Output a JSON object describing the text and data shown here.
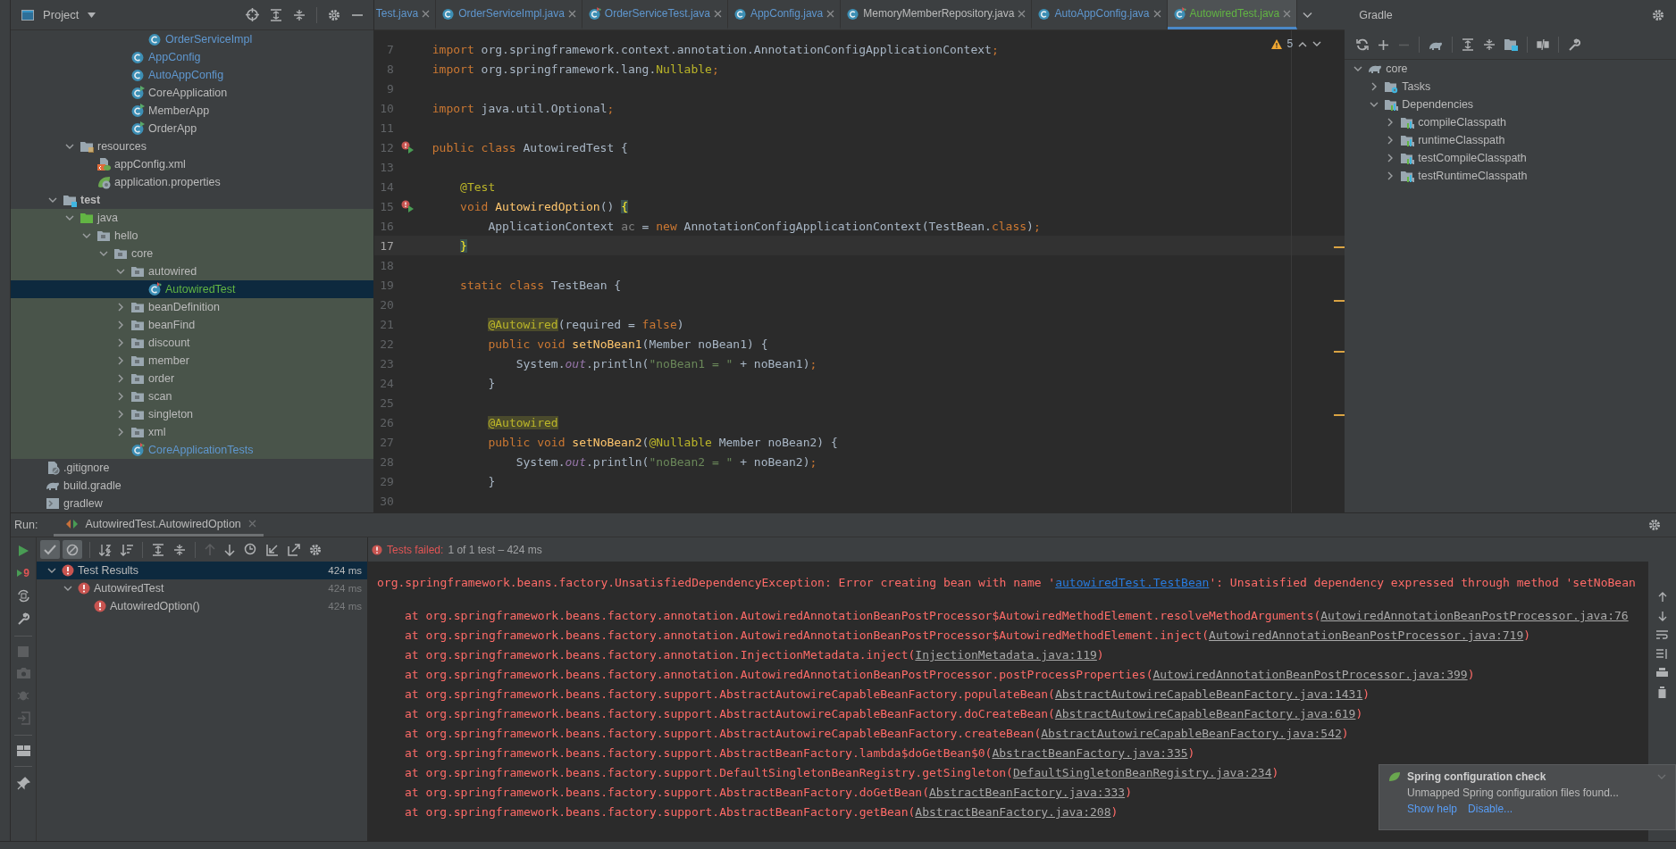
{
  "project": {
    "title": "Project",
    "tree": [
      {
        "children": [
          {
            "children": [
              {
                "children": [
                  {
                    "children": [
                      {
                        "children": [
                          {
                            "children": [
                              {
                                "label": "OrderServiceImpl",
                                "kind": "class",
                                "color": "#5f97cf",
                                "selected": false
                              }
                            ]
                          },
                          {
                            "label": "AppConfig",
                            "kind": "class",
                            "color": "#5f97cf",
                            "selected": false
                          },
                          {
                            "label": "AutoAppConfig",
                            "kind": "class",
                            "color": "#5f97cf",
                            "selected": false
                          },
                          {
                            "label": "CoreApplication",
                            "kind": "class-run",
                            "color": "#bbbbbb",
                            "selected": false
                          },
                          {
                            "label": "MemberApp",
                            "kind": "class-run",
                            "color": "#bbbbbb",
                            "selected": false
                          },
                          {
                            "label": "OrderApp",
                            "kind": "class-run",
                            "color": "#bbbbbb",
                            "selected": false
                          }
                        ]
                      }
                    ]
                  }
                ]
              },
              {
                "label": "resources",
                "kind": "folder-res",
                "color": "#bbbbbb",
                "selected": false,
                "expanded": true,
                "children": [
                  {
                    "label": "appConfig.xml",
                    "kind": "xml",
                    "color": "#bbbbbb",
                    "selected": false
                  },
                  {
                    "label": "application.properties",
                    "kind": "props",
                    "color": "#bbbbbb",
                    "selected": false
                  }
                ]
              }
            ]
          },
          {
            "label": "test",
            "kind": "folder-test",
            "color": "#bbbbbb",
            "bold": true,
            "selected": false,
            "expanded": true,
            "children": [
              {
                "label": "java",
                "kind": "folder-src",
                "color": "#bbbbbb",
                "test_scope": true,
                "selected": false,
                "expanded": true,
                "children": [
                  {
                    "label": "hello",
                    "kind": "folder",
                    "color": "#bbbbbb",
                    "selected": false,
                    "expanded": true,
                    "children": [
                      {
                        "label": "core",
                        "kind": "folder",
                        "color": "#bbbbbb",
                        "selected": false,
                        "expanded": true,
                        "children": [
                          {
                            "label": "autowired",
                            "kind": "folder",
                            "color": "#bbbbbb",
                            "selected": false,
                            "expanded": true,
                            "children": [
                              {
                                "label": "AutowiredTest",
                                "kind": "class-test",
                                "color": "#62b543",
                                "selected": true
                              }
                            ]
                          },
                          {
                            "label": "beanDefinition",
                            "kind": "folder",
                            "color": "#bbbbbb",
                            "selected": false,
                            "expanded": false
                          },
                          {
                            "label": "beanFind",
                            "kind": "folder",
                            "color": "#bbbbbb",
                            "selected": false,
                            "expanded": false
                          },
                          {
                            "label": "discount",
                            "kind": "folder",
                            "color": "#bbbbbb",
                            "selected": false,
                            "expanded": false
                          },
                          {
                            "label": "member",
                            "kind": "folder",
                            "color": "#bbbbbb",
                            "selected": false,
                            "expanded": false
                          },
                          {
                            "label": "order",
                            "kind": "folder",
                            "color": "#bbbbbb",
                            "selected": false,
                            "expanded": false
                          },
                          {
                            "label": "scan",
                            "kind": "folder",
                            "color": "#bbbbbb",
                            "selected": false,
                            "expanded": false
                          },
                          {
                            "label": "singleton",
                            "kind": "folder",
                            "color": "#bbbbbb",
                            "selected": false,
                            "expanded": false
                          },
                          {
                            "label": "xml",
                            "kind": "folder",
                            "color": "#bbbbbb",
                            "selected": false,
                            "expanded": false
                          },
                          {
                            "label": "CoreApplicationTests",
                            "kind": "class-test",
                            "color": "#5f97cf",
                            "selected": false
                          }
                        ]
                      }
                    ]
                  }
                ]
              }
            ]
          }
        ]
      },
      {
        "label": ".gitignore",
        "kind": "gitignore",
        "color": "#bbbbbb",
        "selected": false
      },
      {
        "label": "build.gradle",
        "kind": "gradle",
        "color": "#bbbbbb",
        "selected": false
      },
      {
        "label": "gradlew",
        "kind": "script",
        "color": "#bbbbbb",
        "selected": false
      }
    ]
  },
  "tabs": [
    {
      "label": "Test.java",
      "color": "#5f97cf",
      "selected": false
    },
    {
      "label": "OrderServiceImpl.java",
      "kind": "class",
      "color": "#5f97cf",
      "selected": false
    },
    {
      "label": "OrderServiceTest.java",
      "kind": "class-test",
      "color": "#5f97cf",
      "selected": false
    },
    {
      "label": "AppConfig.java",
      "kind": "class",
      "color": "#5f97cf",
      "selected": false
    },
    {
      "label": "MemoryMemberRepository.java",
      "kind": "class",
      "color": "#bbbbbb",
      "selected": false
    },
    {
      "label": "AutoAppConfig.java",
      "kind": "class",
      "color": "#5f97cf",
      "selected": false
    },
    {
      "label": "AutowiredTest.java",
      "kind": "class-test",
      "color": "#62b543",
      "selected": true
    }
  ],
  "editor": {
    "warnings": "5",
    "lines": [
      {
        "number": "7",
        "current": false,
        "run": false,
        "tokens": [
          {
            "kind": "kw",
            "text": "import"
          },
          {
            "kind": "plain",
            "text": " org.springframework.context.annotation.AnnotationConfigApplicationContext"
          },
          {
            "kind": "kw",
            "text": ";"
          }
        ]
      },
      {
        "number": "8",
        "current": false,
        "run": false,
        "tokens": [
          {
            "kind": "kw",
            "text": "import"
          },
          {
            "kind": "plain",
            "text": " org.springframework.lang."
          },
          {
            "kind": "ann",
            "text": "Nullable"
          },
          {
            "kind": "kw",
            "text": ";"
          }
        ]
      },
      {
        "number": "9",
        "current": false,
        "run": false
      },
      {
        "number": "10",
        "current": false,
        "run": false,
        "tokens": [
          {
            "kind": "kw",
            "text": "import"
          },
          {
            "kind": "plain",
            "text": " java.util.Optional"
          },
          {
            "kind": "kw",
            "text": ";"
          }
        ]
      },
      {
        "number": "11",
        "current": false,
        "run": false
      },
      {
        "number": "12",
        "current": false,
        "run": true,
        "tokens": [
          {
            "kind": "kw",
            "text": "public class"
          },
          {
            "kind": "plain",
            "text": " AutowiredTest {"
          }
        ]
      },
      {
        "number": "13",
        "current": false,
        "run": false
      },
      {
        "number": "14",
        "current": false,
        "run": false,
        "tokens": [
          {
            "kind": "ann",
            "text": "    @Test"
          }
        ]
      },
      {
        "number": "15",
        "current": false,
        "run": true,
        "tokens": [
          {
            "kind": "kw",
            "text": "    void"
          },
          {
            "kind": "decl",
            "text": " AutowiredOption"
          },
          {
            "kind": "plain",
            "text": "() "
          },
          {
            "kind": "brace",
            "text": "{"
          }
        ]
      },
      {
        "number": "16",
        "current": false,
        "run": false,
        "tokens": [
          {
            "kind": "plain",
            "text": "        ApplicationContext "
          },
          {
            "kind": "unused",
            "text": "ac"
          },
          {
            "kind": "plain",
            "text": " = "
          },
          {
            "kind": "kw",
            "text": "new"
          },
          {
            "kind": "plain",
            "text": " AnnotationConfigApplicationContext(TestBean."
          },
          {
            "kind": "kw",
            "text": "class"
          },
          {
            "kind": "plain",
            "text": ")"
          },
          {
            "kind": "kw",
            "text": ";"
          }
        ]
      },
      {
        "number": "17",
        "current": true,
        "run": false,
        "tokens": [
          {
            "kind": "brace",
            "text": "    }"
          }
        ]
      },
      {
        "number": "18",
        "current": false,
        "run": false
      },
      {
        "number": "19",
        "current": false,
        "run": false,
        "tokens": [
          {
            "kind": "kw",
            "text": "    static class"
          },
          {
            "kind": "plain",
            "text": " TestBean {"
          }
        ]
      },
      {
        "number": "20",
        "current": false,
        "run": false
      },
      {
        "number": "21",
        "current": false,
        "run": false,
        "tokens": [
          {
            "kind": "ann-hl",
            "text": "        @Autowired"
          },
          {
            "kind": "plain",
            "text": "(required = "
          },
          {
            "kind": "kw",
            "text": "false"
          },
          {
            "kind": "plain",
            "text": ")"
          }
        ]
      },
      {
        "number": "22",
        "current": false,
        "run": false,
        "tokens": [
          {
            "kind": "kw",
            "text": "        public void"
          },
          {
            "kind": "decl",
            "text": " setNoBean1"
          },
          {
            "kind": "plain",
            "text": "(Member noBean1) {"
          }
        ]
      },
      {
        "number": "23",
        "current": false,
        "run": false,
        "tokens": [
          {
            "kind": "plain",
            "text": "            System."
          },
          {
            "kind": "field",
            "text": "out"
          },
          {
            "kind": "plain",
            "text": ".println("
          },
          {
            "kind": "str",
            "text": "\"noBean1 = \""
          },
          {
            "kind": "plain",
            "text": " + noBean1)"
          },
          {
            "kind": "kw",
            "text": ";"
          }
        ]
      },
      {
        "number": "24",
        "current": false,
        "run": false,
        "tokens": [
          {
            "kind": "plain",
            "text": "        }"
          }
        ]
      },
      {
        "number": "25",
        "current": false,
        "run": false
      },
      {
        "number": "26",
        "current": false,
        "run": false,
        "tokens": [
          {
            "kind": "ann-hl",
            "text": "        @Autowired"
          }
        ]
      },
      {
        "number": "27",
        "current": false,
        "run": false,
        "tokens": [
          {
            "kind": "kw",
            "text": "        public void"
          },
          {
            "kind": "decl",
            "text": " setNoBean2"
          },
          {
            "kind": "plain",
            "text": "("
          },
          {
            "kind": "ann",
            "text": "@Nullable"
          },
          {
            "kind": "plain",
            "text": " Member noBean2) {"
          }
        ]
      },
      {
        "number": "28",
        "current": false,
        "run": false,
        "tokens": [
          {
            "kind": "plain",
            "text": "            System."
          },
          {
            "kind": "field",
            "text": "out"
          },
          {
            "kind": "plain",
            "text": ".println("
          },
          {
            "kind": "str",
            "text": "\"noBean2 = \""
          },
          {
            "kind": "plain",
            "text": " + noBean2)"
          },
          {
            "kind": "kw",
            "text": ";"
          }
        ]
      },
      {
        "number": "29",
        "current": false,
        "run": false,
        "tokens": [
          {
            "kind": "plain",
            "text": "        }"
          }
        ]
      },
      {
        "number": "30",
        "current": false,
        "run": false
      }
    ]
  },
  "gradle": {
    "title": "Gradle",
    "tree": [
      {
        "label": "core",
        "kind": "gradle",
        "expanded": true,
        "children": [
          {
            "label": "Tasks",
            "kind": "tasks",
            "expanded": false
          },
          {
            "label": "Dependencies",
            "kind": "deps",
            "expanded": true,
            "children": [
              {
                "label": "compileClasspath",
                "kind": "deps",
                "expanded": false
              },
              {
                "label": "runtimeClasspath",
                "kind": "deps",
                "expanded": false
              },
              {
                "label": "testCompileClasspath",
                "kind": "deps",
                "expanded": false
              },
              {
                "label": "testRuntimeClasspath",
                "kind": "deps",
                "expanded": false
              }
            ]
          }
        ]
      }
    ]
  },
  "run": {
    "label": "Run:",
    "tab": "AutowiredTest.AutowiredOption",
    "failed_count": "9",
    "tree": [
      {
        "label": "Test Results",
        "time": "424 ms",
        "kind": "failed",
        "selected": true,
        "expanded": true,
        "children": [
          {
            "label": "AutowiredTest",
            "time": "424 ms",
            "kind": "failed",
            "selected": false,
            "expanded": true,
            "children": [
              {
                "label": "AutowiredOption()",
                "time": "424 ms",
                "kind": "failed",
                "selected": false
              }
            ]
          }
        ]
      }
    ],
    "status_label": "Tests failed:",
    "status_detail": "1 of 1 test – 424 ms",
    "output": [
      {
        "kind": "exception",
        "text": "org.springframework.beans.factory.UnsatisfiedDependencyException: Error creating bean with name '",
        "link": "autowiredTest.TestBean",
        "tail": "': Unsatisfied dependency expressed through method 'setNoBean"
      },
      {
        "kind": "frame",
        "text": "at org.springframework.beans.factory.annotation.AutowiredAnnotationBeanPostProcessor$AutowiredMethodElement.resolveMethodArguments(",
        "link": "AutowiredAnnotationBeanPostProcessor.java:76"
      },
      {
        "kind": "frame",
        "text": "at org.springframework.beans.factory.annotation.AutowiredAnnotationBeanPostProcessor$AutowiredMethodElement.inject(",
        "link": "AutowiredAnnotationBeanPostProcessor.java:719",
        "tail": ")"
      },
      {
        "kind": "frame",
        "text": "at org.springframework.beans.factory.annotation.InjectionMetadata.inject(",
        "link": "InjectionMetadata.java:119",
        "tail": ")"
      },
      {
        "kind": "frame",
        "text": "at org.springframework.beans.factory.annotation.AutowiredAnnotationBeanPostProcessor.postProcessProperties(",
        "link": "AutowiredAnnotationBeanPostProcessor.java:399",
        "tail": ")"
      },
      {
        "kind": "frame",
        "text": "at org.springframework.beans.factory.support.AbstractAutowireCapableBeanFactory.populateBean(",
        "link": "AbstractAutowireCapableBeanFactory.java:1431",
        "tail": ")"
      },
      {
        "kind": "frame",
        "text": "at org.springframework.beans.factory.support.AbstractAutowireCapableBeanFactory.doCreateBean(",
        "link": "AbstractAutowireCapableBeanFactory.java:619",
        "tail": ")"
      },
      {
        "kind": "frame",
        "text": "at org.springframework.beans.factory.support.AbstractAutowireCapableBeanFactory.createBean(",
        "link": "AbstractAutowireCapableBeanFactory.java:542",
        "tail": ")"
      },
      {
        "kind": "frame",
        "text": "at org.springframework.beans.factory.support.AbstractBeanFactory.lambda$doGetBean$0(",
        "link": "AbstractBeanFactory.java:335",
        "tail": ")"
      },
      {
        "kind": "frame",
        "text": "at org.springframework.beans.factory.support.DefaultSingletonBeanRegistry.getSingleton(",
        "link": "DefaultSingletonBeanRegistry.java:234",
        "tail": ")"
      },
      {
        "kind": "frame",
        "text": "at org.springframework.beans.factory.support.AbstractBeanFactory.doGetBean(",
        "link": "AbstractBeanFactory.java:333",
        "tail": ")"
      },
      {
        "kind": "frame",
        "text": "at org.springframework.beans.factory.support.AbstractBeanFactory.getBean(",
        "link": "AbstractBeanFactory.java:208",
        "tail": ")"
      }
    ]
  },
  "notification": {
    "title": "Spring configuration check",
    "message": "Unmapped Spring configuration files found...",
    "actions": [
      "Show help",
      "Disable..."
    ]
  }
}
